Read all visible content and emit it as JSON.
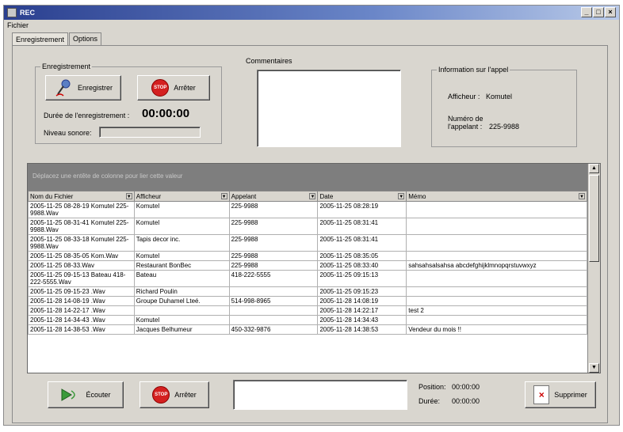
{
  "window": {
    "title": "REC",
    "controls": [
      "_",
      "□",
      "×"
    ]
  },
  "menu": {
    "fichier": "Fichier"
  },
  "tabs": [
    {
      "label": "Enregistrement"
    },
    {
      "label": "Options"
    }
  ],
  "recording": {
    "group_label": "Enregistrement",
    "record_button": "Enregistrer",
    "stop_button": "Arrêter",
    "stop_icon_text": "STOP",
    "duration_label": "Durée de l'enregistrement :",
    "duration_value": "00:00:00",
    "level_label": "Niveau sonore:"
  },
  "comments": {
    "label": "Commentaires"
  },
  "call_info": {
    "group_label": "Information sur l'appel",
    "display_label": "Afficheur :",
    "display_value": "Komutel",
    "number_label_1": "Numéro de",
    "number_label_2": "l'appelant :",
    "number_value": "225-9988"
  },
  "grid": {
    "group_hint": "Déplacez une entête de colonne pour lier cette valeur",
    "columns": [
      "Nom du Fichier",
      "Afficheur",
      "Appelant",
      "Date",
      "Mémo"
    ],
    "rows": [
      [
        "2005-11-25 08-28-19 Komutel 225-9988.Wav",
        "Komutel",
        "225-9988",
        "2005-11-25 08:28:19",
        ""
      ],
      [
        "2005-11-25 08-31-41 Komutel 225-9988.Wav",
        "Komutel",
        "225-9988",
        "2005-11-25 08:31:41",
        ""
      ],
      [
        "2005-11-25 08-33-18 Komutel 225-9988.Wav",
        "Tapis decor inc.",
        "225-9988",
        "2005-11-25 08:31:41",
        ""
      ],
      [
        "2005-11-25 08-35-05 Kom.Wav",
        "Komutel",
        "225-9988",
        "2005-11-25 08:35:05",
        ""
      ],
      [
        "2005-11-25 08-33.Wav",
        "Restaurant BonBec",
        "225-9988",
        "2005-11-25 08:33:40",
        "sahsahsalsahsa abcdefghijklmnopqrstuvwxyz"
      ],
      [
        "2005-11-25 09-15-13 Bateau 418-222-5555.Wav",
        "Bateau",
        "418-222-5555",
        "2005-11-25 09:15:13",
        ""
      ],
      [
        "2005-11-25 09-15-23 .Wav",
        "Richard Poulin",
        "",
        "2005-11-25 09:15:23",
        ""
      ],
      [
        "2005-11-28 14-08-19 .Wav",
        "Groupe Duhamel Lteé.",
        "514-998-8965",
        "2005-11-28 14:08:19",
        ""
      ],
      [
        "2005-11-28 14-22-17 .Wav",
        "",
        "",
        "2005-11-28 14:22:17",
        "test 2"
      ],
      [
        "2005-11-28 14-34-43 .Wav",
        "Komutel",
        "",
        "2005-11-28 14:34:43",
        ""
      ],
      [
        "2005-11-28 14-38-53 .Wav",
        "Jacques Belhumeur",
        "450-332-9876",
        "2005-11-28 14:38:53",
        "Vendeur du mois !!"
      ]
    ]
  },
  "bottom": {
    "listen_button": "Écouter",
    "stop_button": "Arrêter",
    "stop_icon_text": "STOP",
    "position_label": "Position:",
    "position_value": "00:00:00",
    "duration_label": "Durée:",
    "duration_value": "00:00:00",
    "delete_button": "Supprimer"
  }
}
